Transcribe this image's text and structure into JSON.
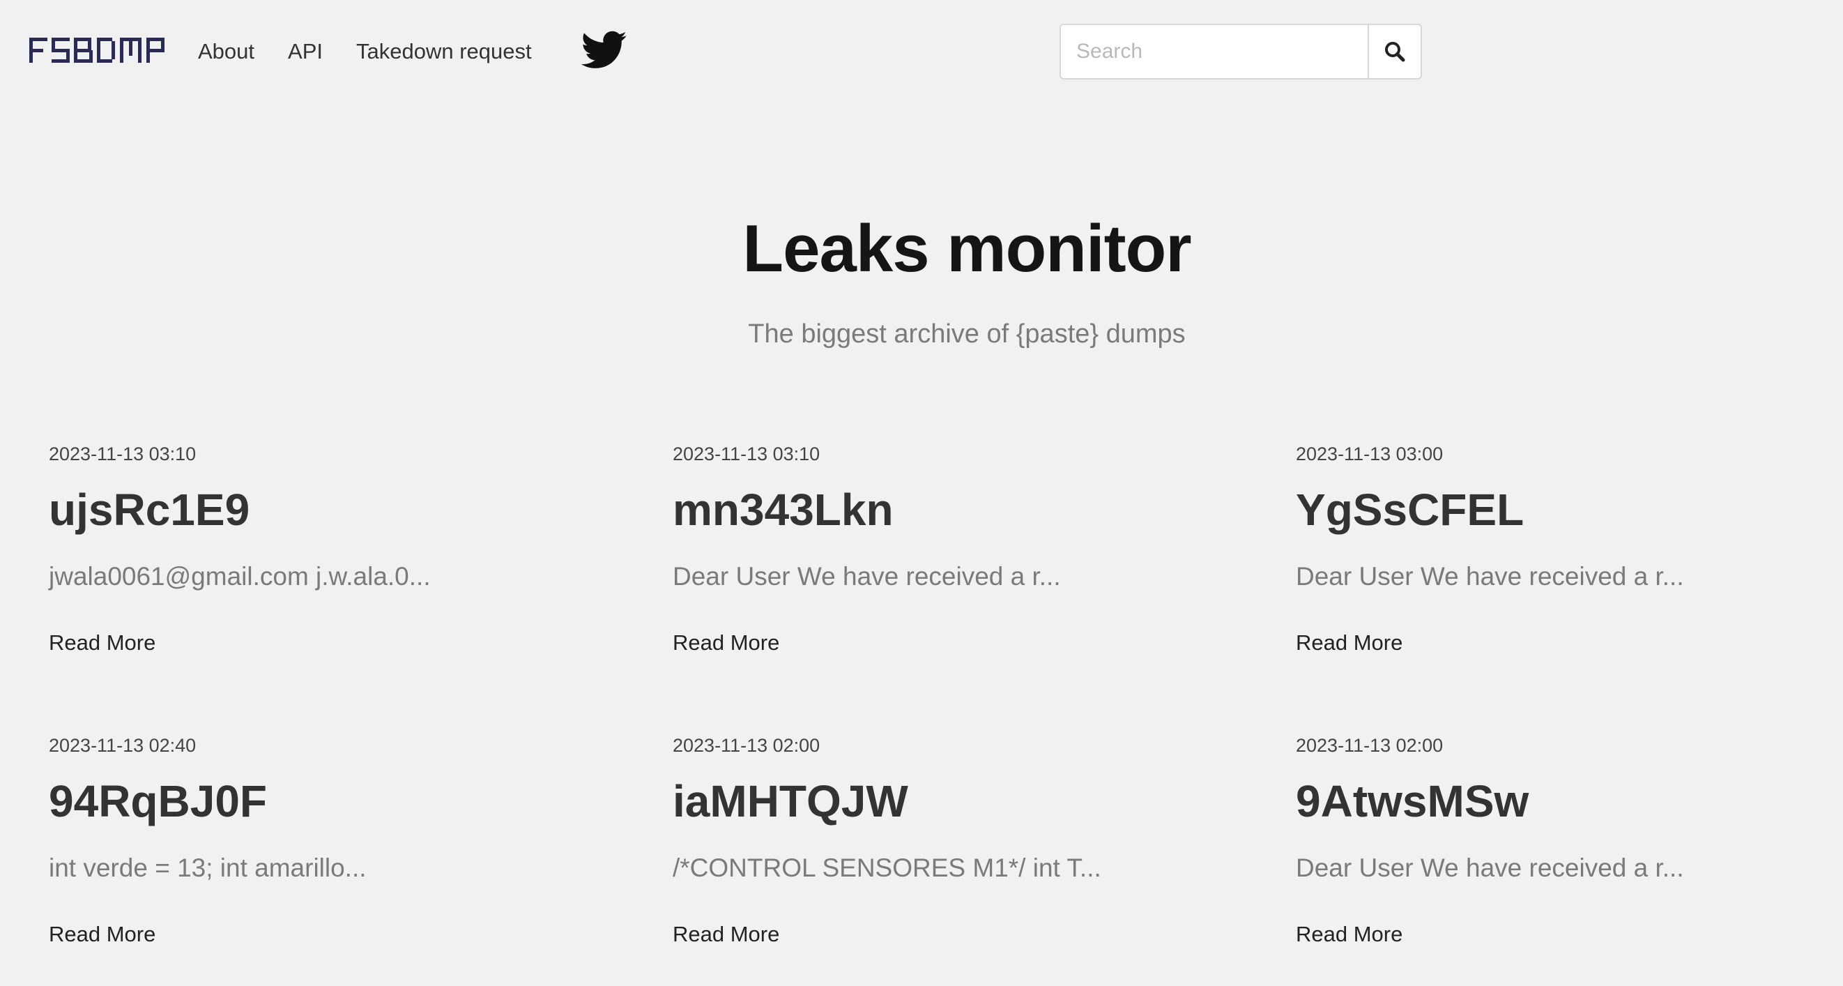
{
  "nav": {
    "logo_text": "FSBDMP",
    "links": [
      "About",
      "API",
      "Takedown request"
    ]
  },
  "search": {
    "placeholder": "Search",
    "value": ""
  },
  "hero": {
    "title": "Leaks monitor",
    "subtitle": "The biggest archive of {paste} dumps"
  },
  "cards": [
    {
      "date": "2023-11-13 03:10",
      "title": "ujsRc1E9",
      "excerpt": "jwala0061@gmail.com j.w.ala.0...",
      "link": "Read More"
    },
    {
      "date": "2023-11-13 03:10",
      "title": "mn343Lkn",
      "excerpt": "Dear User We have received a r...",
      "link": "Read More"
    },
    {
      "date": "2023-11-13 03:00",
      "title": "YgSsCFEL",
      "excerpt": "Dear User We have received a r...",
      "link": "Read More"
    },
    {
      "date": "2023-11-13 02:40",
      "title": "94RqBJ0F",
      "excerpt": "int verde = 13; int amarillo...",
      "link": "Read More"
    },
    {
      "date": "2023-11-13 02:00",
      "title": "iaMHTQJW",
      "excerpt": "/*CONTROL SENSORES M1*/ int T...",
      "link": "Read More"
    },
    {
      "date": "2023-11-13 02:00",
      "title": "9AtwsMSw",
      "excerpt": "Dear User We have received a r...",
      "link": "Read More"
    }
  ],
  "colors": {
    "background": "#f1f1f1",
    "logo": "#2a2a55",
    "twitter": "#111111"
  },
  "icons": {
    "twitter": "twitter-icon",
    "search": "search-icon"
  }
}
